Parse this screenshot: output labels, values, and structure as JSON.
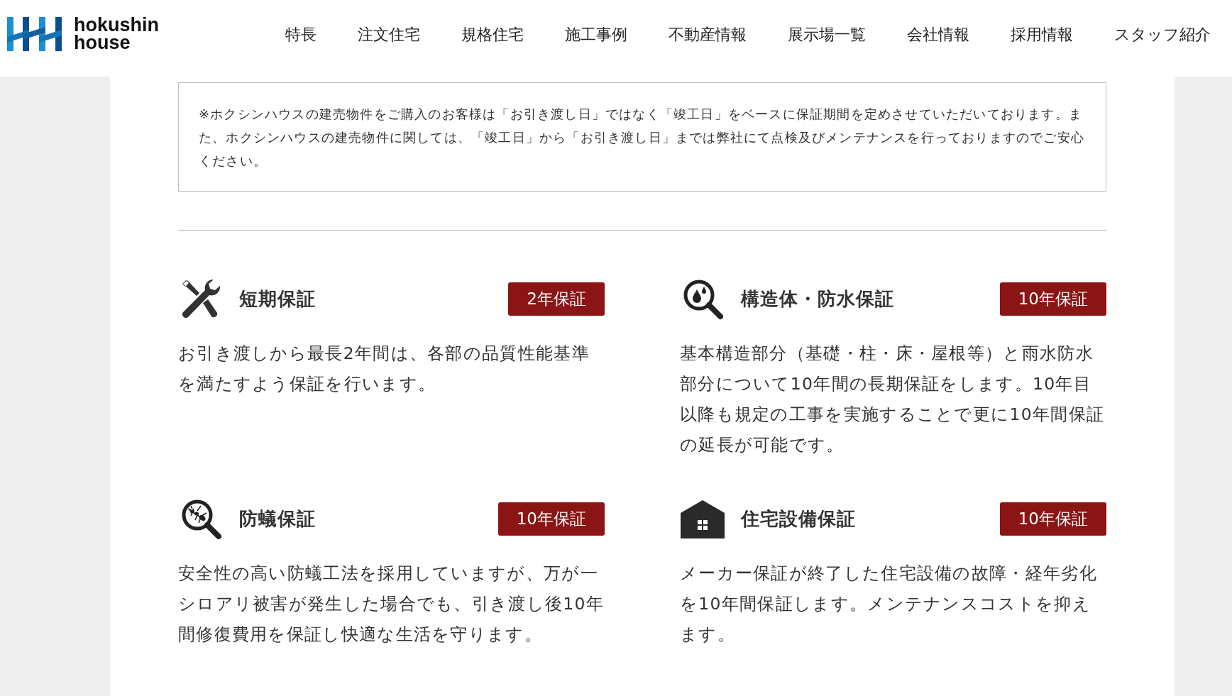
{
  "header": {
    "logo_text": [
      "hokushin",
      "house"
    ],
    "nav": [
      "特長",
      "注文住宅",
      "規格住宅",
      "施工事例",
      "不動産情報",
      "展示場一覧",
      "会社情報",
      "採用情報",
      "スタッフ紹介"
    ]
  },
  "note": "※ホクシンハウスの建売物件をご購入のお客様は「お引き渡し日」ではなく「竣工日」をベースに保証期間を定めさせていただいております。また、ホクシンハウスの建売物件に関しては、「竣工日」から「お引き渡し日」までは弊社にて点検及びメンテナンスを行っておりますのでご安心ください。",
  "warranties": [
    {
      "kind": "tools",
      "title": "短期保証",
      "badge": "2年保証",
      "text": "お引き渡しから最長2年間は、各部の品質性能基準を満たすよう保証を行います。"
    },
    {
      "kind": "water",
      "title": "構造体・防水保証",
      "badge": "10年保証",
      "text": "基本構造部分（基礎・柱・床・屋根等）と雨水防水部分について10年間の長期保証をします。10年目以降も規定の工事を実施することで更に10年間保証の延長が可能です。"
    },
    {
      "kind": "ant",
      "title": "防蟻保証",
      "badge": "10年保証",
      "text": "安全性の高い防蟻工法を採用していますが、万が一シロアリ被害が発生した場合でも、引き渡し後10年間修復費用を保証し快適な生活を守ります。"
    },
    {
      "kind": "house",
      "title": "住宅設備保証",
      "badge": "10年保証",
      "text": "メーカー保証が終了した住宅設備の故障・経年劣化を10年間保証します。メンテナンスコストを抑えます。"
    }
  ]
}
